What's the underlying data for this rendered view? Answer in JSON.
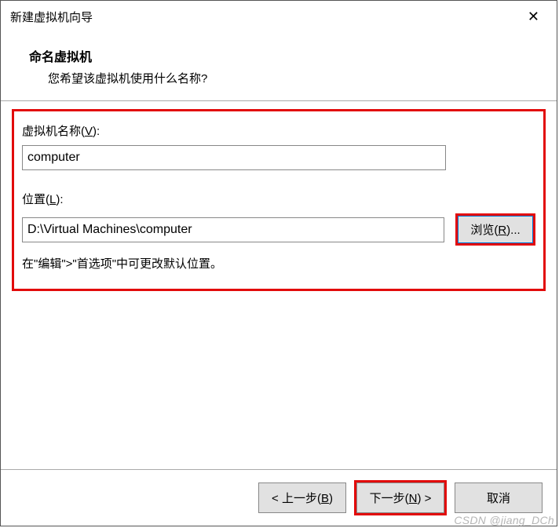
{
  "titlebar": {
    "title": "新建虚拟机向导"
  },
  "header": {
    "title": "命名虚拟机",
    "subtitle": "您希望该虚拟机使用什么名称?"
  },
  "form": {
    "name_label_prefix": "虚拟机名称(",
    "name_label_key": "V",
    "name_label_suffix": "):",
    "name_value": "computer",
    "location_label_prefix": "位置(",
    "location_label_key": "L",
    "location_label_suffix": "):",
    "location_value": "D:\\Virtual Machines\\computer",
    "browse_prefix": "浏览(",
    "browse_key": "R",
    "browse_suffix": ")...",
    "hint": "在\"编辑\">\"首选项\"中可更改默认位置。"
  },
  "footer": {
    "back_prefix": "< 上一步(",
    "back_key": "B",
    "back_suffix": ")",
    "next_prefix": "下一步(",
    "next_key": "N",
    "next_suffix": ") >",
    "cancel": "取消"
  },
  "watermark": "CSDN @jiang_DCh"
}
